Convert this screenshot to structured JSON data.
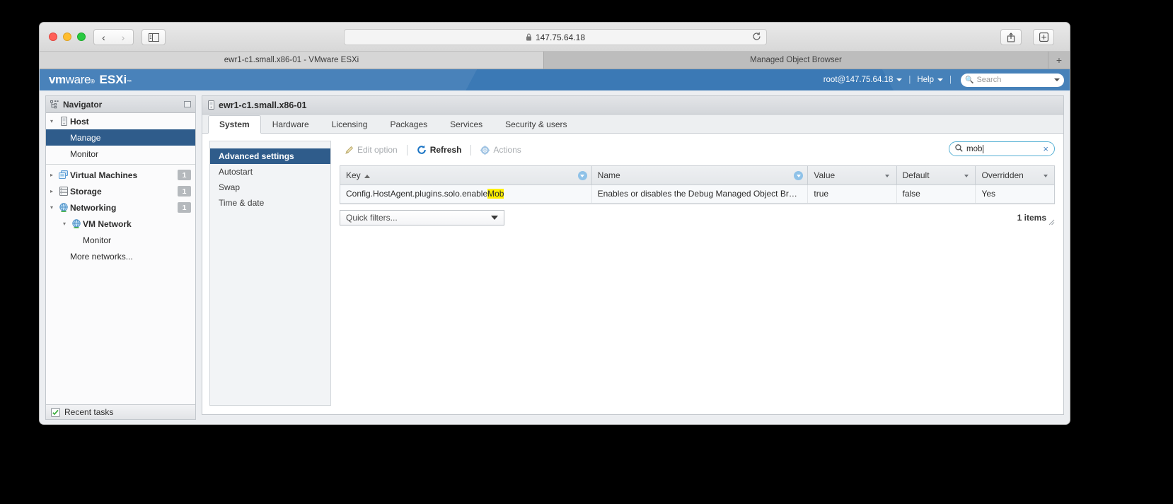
{
  "browser": {
    "url": "147.75.64.18",
    "lock_icon": "lock-icon",
    "reload_icon": "reload-icon",
    "back_icon": "chevron-left-icon",
    "forward_icon": "chevron-right-icon",
    "sidebar_icon": "sidebar-toggle-icon",
    "share_icon": "share-icon",
    "newtab_icon": "plus-icon",
    "tabs": [
      {
        "label": "ewr1-c1.small.x86-01 - VMware ESXi",
        "active": true
      },
      {
        "label": "Managed Object Browser",
        "active": false
      }
    ],
    "new_tab_label": "+"
  },
  "esxi_header": {
    "logo_vm": "vm",
    "logo_ware": "ware",
    "logo_reg": "®",
    "logo_product": "ESXi",
    "logo_tm": "™",
    "user": "root@147.75.64.18",
    "help": "Help",
    "separator": "|",
    "search_placeholder": "Search",
    "search_icon": "search-icon"
  },
  "navigator": {
    "title": "Navigator",
    "title_icon": "navigator-tree-icon",
    "minimize_icon": "minimize-panel-icon",
    "items": [
      {
        "label": "Host",
        "icon": "host-icon",
        "twisty": "▾",
        "indent": 0,
        "bold": true,
        "selected": false,
        "badge": ""
      },
      {
        "label": "Manage",
        "icon": "",
        "twisty": "",
        "indent": 1,
        "bold": false,
        "selected": true,
        "badge": ""
      },
      {
        "label": "Monitor",
        "icon": "",
        "twisty": "",
        "indent": 1,
        "bold": false,
        "selected": false,
        "badge": ""
      },
      {
        "label": "Virtual Machines",
        "icon": "vm-icon",
        "twisty": "▸",
        "indent": 0,
        "bold": true,
        "selected": false,
        "badge": "1"
      },
      {
        "label": "Storage",
        "icon": "storage-icon",
        "twisty": "▸",
        "indent": 0,
        "bold": true,
        "selected": false,
        "badge": "1"
      },
      {
        "label": "Networking",
        "icon": "network-icon",
        "twisty": "▾",
        "indent": 0,
        "bold": true,
        "selected": false,
        "badge": "1"
      },
      {
        "label": "VM Network",
        "icon": "network-icon",
        "twisty": "▾",
        "indent": 1,
        "bold": true,
        "selected": false,
        "badge": ""
      },
      {
        "label": "Monitor",
        "icon": "",
        "twisty": "",
        "indent": 2,
        "bold": false,
        "selected": false,
        "badge": ""
      },
      {
        "label": "More networks...",
        "icon": "",
        "twisty": "",
        "indent": 1,
        "bold": false,
        "selected": false,
        "badge": ""
      }
    ]
  },
  "content": {
    "object_title": "ewr1-c1.small.x86-01",
    "object_icon": "host-icon",
    "tabs": [
      {
        "label": "System",
        "active": true
      },
      {
        "label": "Hardware",
        "active": false
      },
      {
        "label": "Licensing",
        "active": false
      },
      {
        "label": "Packages",
        "active": false
      },
      {
        "label": "Services",
        "active": false
      },
      {
        "label": "Security & users",
        "active": false
      }
    ],
    "subnav": [
      {
        "label": "Advanced settings",
        "active": true
      },
      {
        "label": "Autostart",
        "active": false
      },
      {
        "label": "Swap",
        "active": false
      },
      {
        "label": "Time & date",
        "active": false
      }
    ],
    "toolbar": {
      "edit_option_label": "Edit option",
      "edit_option_icon": "pencil-icon",
      "edit_option_enabled": false,
      "refresh_label": "Refresh",
      "refresh_icon": "refresh-icon",
      "refresh_enabled": true,
      "actions_label": "Actions",
      "actions_icon": "gear-icon",
      "actions_enabled": false,
      "separator": "|"
    },
    "search": {
      "value": "mob",
      "icon": "search-icon",
      "clear_icon": "clear-icon",
      "clear_glyph": "×"
    },
    "table": {
      "columns": [
        {
          "label": "Key",
          "sorted": "asc",
          "menu": "active"
        },
        {
          "label": "Name",
          "sorted": "",
          "menu": "active"
        },
        {
          "label": "Value",
          "sorted": "",
          "menu": "plain"
        },
        {
          "label": "Default",
          "sorted": "",
          "menu": "plain"
        },
        {
          "label": "Overridden",
          "sorted": "",
          "menu": "plain"
        }
      ],
      "rows": [
        {
          "key_prefix": "Config.HostAgent.plugins.solo.enable",
          "key_highlight": "Mob",
          "key_suffix": "",
          "name": "Enables or disables the Debug Managed Object Bro…",
          "value": "true",
          "default": "false",
          "overridden": "Yes"
        }
      ],
      "quick_filters_label": "Quick filters...",
      "items_count": "1 items",
      "resize_grip_icon": "resize-grip-icon"
    }
  },
  "recent_tasks": {
    "label": "Recent tasks",
    "icon": "tasks-icon"
  }
}
